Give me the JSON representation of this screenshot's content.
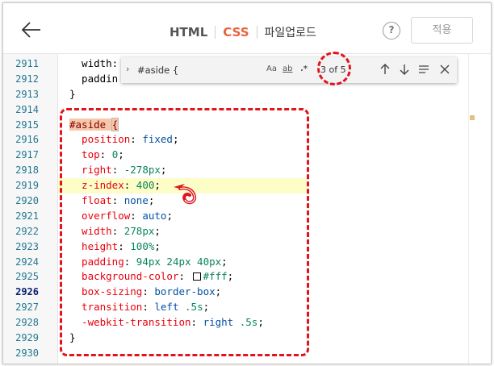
{
  "header": {
    "back_label": "back",
    "tabs": [
      {
        "label": "HTML",
        "active": false
      },
      {
        "label": "CSS",
        "active": true
      },
      {
        "label": "파일업로드",
        "active": false
      }
    ],
    "help_label": "?",
    "apply_label": "적용"
  },
  "find": {
    "query": "#aside {",
    "match_case": "Aa",
    "whole_word": "ab",
    "regex": ".*",
    "count": "3 of 5"
  },
  "editor": {
    "lines": [
      {
        "n": "2911",
        "code": "  width:"
      },
      {
        "n": "2912",
        "code": "  paddin"
      },
      {
        "n": "2913",
        "code": "}"
      },
      {
        "n": "2914",
        "code": ""
      },
      {
        "n": "2915",
        "sel": "#aside ",
        "brace": "{"
      },
      {
        "n": "2916",
        "prop": "  position",
        "val": "fixed"
      },
      {
        "n": "2917",
        "prop": "  top",
        "num": "0"
      },
      {
        "n": "2918",
        "prop": "  right",
        "num": "-278px"
      },
      {
        "n": "2919",
        "prop": "  z-index",
        "num": "400"
      },
      {
        "n": "2920",
        "prop": "  float",
        "val": "none"
      },
      {
        "n": "2921",
        "prop": "  overflow",
        "val": "auto"
      },
      {
        "n": "2922",
        "prop": "  width",
        "num": "278px"
      },
      {
        "n": "2923",
        "prop": "  height",
        "num": "100%"
      },
      {
        "n": "2924",
        "prop": "  padding",
        "num": "94px 24px 40px"
      },
      {
        "n": "2925",
        "prop": "  background-color",
        "num": "#fff"
      },
      {
        "n": "2926",
        "prop": "  box-sizing",
        "val": "border-box"
      },
      {
        "n": "2927",
        "prop": "  transition",
        "val": "left ",
        "num2": ".5s"
      },
      {
        "n": "2928",
        "prop": "  -webkit-transition",
        "val": "right ",
        "num2": ".5s"
      },
      {
        "n": "2929",
        "code": "}"
      },
      {
        "n": "2930",
        "code": ""
      }
    ]
  },
  "colors": {
    "accent": "#e8623e",
    "annotation": "#e0141c",
    "highlight_line": "#fdfdc8"
  }
}
